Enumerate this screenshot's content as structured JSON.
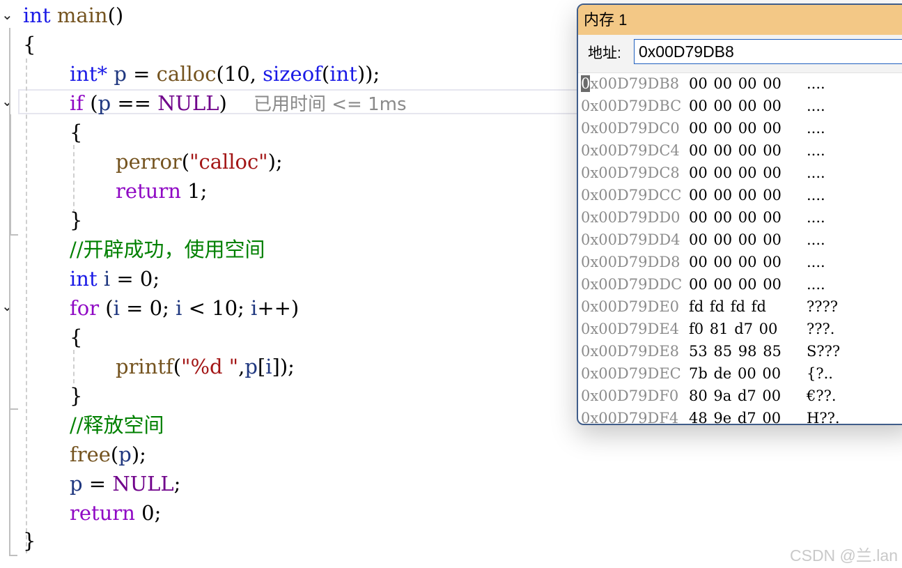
{
  "editor": {
    "tokens": {
      "int": "int",
      "main": "main",
      "paren_open": "(",
      "paren_close": ")",
      "int_ptr": "int*",
      "p": "p",
      "calloc": "calloc",
      "ten": "10",
      "sizeof": "sizeof",
      "if": "if",
      "null": "NULL",
      "eqeq": "==",
      "perror": "perror",
      "calloc_str": "\"calloc\"",
      "return": "return",
      "one": "1",
      "zero": "0",
      "i": "i",
      "for": "for",
      "printf": "printf",
      "fmt_str": "\"%d \"",
      "free": "free"
    },
    "comment_success": "//开辟成功，使用空间",
    "comment_free": "//释放空间",
    "elapsed_hint": "已用时间 <= 1ms"
  },
  "memory_window": {
    "title": "内存 1",
    "address_label": "地址:",
    "address_value": "0x00D79DB8",
    "rows": [
      {
        "addr": "0x00D79DB8",
        "bytes": "00 00 00 00",
        "ascii": "...."
      },
      {
        "addr": "0x00D79DBC",
        "bytes": "00 00 00 00",
        "ascii": "...."
      },
      {
        "addr": "0x00D79DC0",
        "bytes": "00 00 00 00",
        "ascii": "...."
      },
      {
        "addr": "0x00D79DC4",
        "bytes": "00 00 00 00",
        "ascii": "...."
      },
      {
        "addr": "0x00D79DC8",
        "bytes": "00 00 00 00",
        "ascii": "...."
      },
      {
        "addr": "0x00D79DCC",
        "bytes": "00 00 00 00",
        "ascii": "...."
      },
      {
        "addr": "0x00D79DD0",
        "bytes": "00 00 00 00",
        "ascii": "...."
      },
      {
        "addr": "0x00D79DD4",
        "bytes": "00 00 00 00",
        "ascii": "...."
      },
      {
        "addr": "0x00D79DD8",
        "bytes": "00 00 00 00",
        "ascii": "...."
      },
      {
        "addr": "0x00D79DDC",
        "bytes": "00 00 00 00",
        "ascii": "...."
      },
      {
        "addr": "0x00D79DE0",
        "bytes": "fd fd fd fd",
        "ascii": "????"
      },
      {
        "addr": "0x00D79DE4",
        "bytes": "f0 81 d7 00",
        "ascii": "???."
      },
      {
        "addr": "0x00D79DE8",
        "bytes": "53 85 98 85",
        "ascii": "S???"
      },
      {
        "addr": "0x00D79DEC",
        "bytes": "7b de 00 00",
        "ascii": "{?.."
      },
      {
        "addr": "0x00D79DF0",
        "bytes": "80 9a d7 00",
        "ascii": "€??."
      },
      {
        "addr": "0x00D79DF4",
        "bytes": "48 9e d7 00",
        "ascii": "H??."
      }
    ]
  },
  "watermark": "CSDN @兰.lan",
  "colors": {
    "keyword": "#1a1ae6",
    "function": "#74531f",
    "string": "#a31515",
    "comment": "#008000",
    "title_bar": "#f3c886"
  },
  "icons": {
    "fold_toggle": "chevron-down-icon"
  }
}
